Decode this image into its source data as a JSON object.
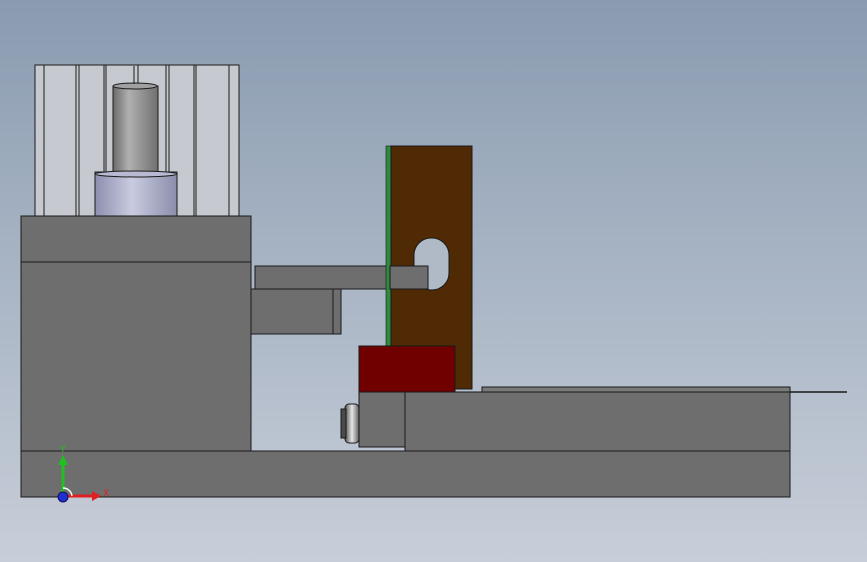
{
  "viewport": {
    "background_top": "#8a9bb0",
    "background_bottom": "#c8ced9"
  },
  "colors": {
    "body_gray": "#6e6e6e",
    "edge": "#1a1a1a",
    "bracket_brown": "#4f2a05",
    "block_red": "#700000",
    "strip_green": "#2e8a3e",
    "cylinder_fin": "#c6c9cf",
    "piston_rod": "#8f8f8f",
    "bushing": "#9da0c0",
    "axis_x": "#e02020",
    "axis_y": "#20c020",
    "axis_z": "#2030d0"
  },
  "triad": {
    "x_label": "X",
    "y_label": "Y",
    "icon": "coordinate-triad-icon"
  }
}
